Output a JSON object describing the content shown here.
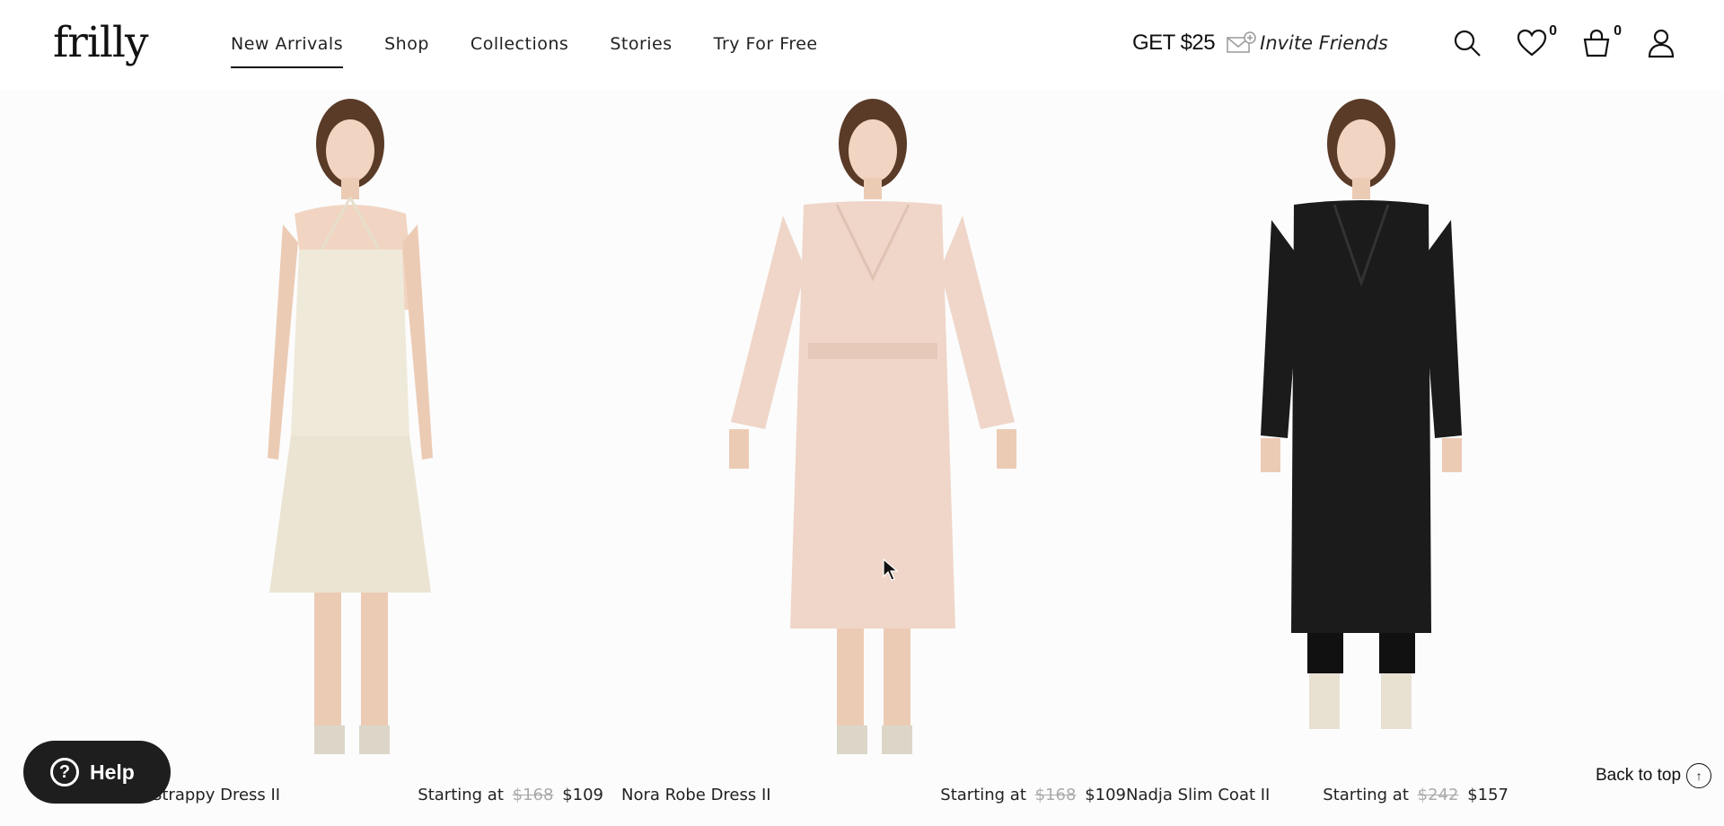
{
  "header": {
    "logo": "frilly",
    "nav": [
      "New Arrivals",
      "Shop",
      "Collections",
      "Stories",
      "Try For Free"
    ],
    "promo_amount": "GET $25",
    "promo_invite": "Invite Friends",
    "wishlist_count": "0",
    "cart_count": "0",
    "icons": [
      "search-icon",
      "heart-icon",
      "bag-icon",
      "user-icon"
    ]
  },
  "products": [
    {
      "name": "Isabel Strappy Dress II",
      "price_prefix": "Starting at",
      "old_price": "$168",
      "price": "$109",
      "garment_color": "#efe9da"
    },
    {
      "name": "Nora Robe Dress II",
      "price_prefix": "Starting at",
      "old_price": "$168",
      "price": "$109",
      "garment_color": "#efd6c8"
    },
    {
      "name": "Nadja Slim Coat II",
      "price_prefix": "Starting at",
      "old_price": "$242",
      "price": "$157",
      "garment_color": "#1b1b1b"
    }
  ],
  "help": {
    "label": "Help"
  },
  "back_to_top": "Back to top"
}
